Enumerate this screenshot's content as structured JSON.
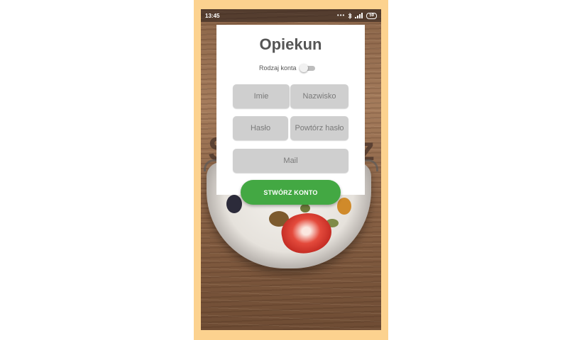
{
  "status_bar": {
    "time": "13:45",
    "dots": "•••",
    "battery": "59"
  },
  "form": {
    "title": "Opiekun",
    "account_type_label": "Rodzaj konta",
    "fields": {
      "first_name_placeholder": "Imie",
      "last_name_placeholder": "Nazwisko",
      "password_placeholder": "Hasło",
      "repeat_password_placeholder": "Powtórz hasło",
      "email_placeholder": "Mail"
    },
    "submit_label": "STWÓRZ KONTO"
  },
  "colors": {
    "frame": "#fcd28f",
    "submit": "#43a843",
    "field_background": "#cfcfcf"
  },
  "icons": [
    "bluetooth-icon",
    "signal-icon",
    "battery-icon"
  ]
}
